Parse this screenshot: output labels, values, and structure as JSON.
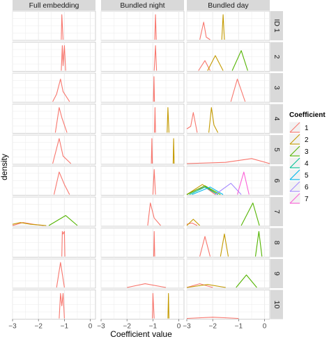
{
  "chart_data": {
    "type": "line",
    "xlabel": "Coefficient value",
    "ylabel": "density",
    "xlim": [
      -3,
      0.2
    ],
    "x_ticks": [
      "−3",
      "−2",
      "−1",
      "0"
    ],
    "x_tick_values": [
      -3,
      -2,
      -1,
      0
    ],
    "grid": true,
    "column_facets": [
      "Full embedding",
      "Bundled night",
      "Bundled day"
    ],
    "row_facets": [
      "ID 1",
      "2",
      "3",
      "4",
      "5",
      "6",
      "7",
      "8",
      "9",
      "10"
    ],
    "legend": {
      "title": "Coefficient",
      "placement": "right",
      "entries": [
        {
          "label": "1",
          "color": "#F8766D"
        },
        {
          "label": "2",
          "color": "#C49A00"
        },
        {
          "label": "3",
          "color": "#53B400"
        },
        {
          "label": "4",
          "color": "#00C094"
        },
        {
          "label": "5",
          "color": "#00B6EB"
        },
        {
          "label": "6",
          "color": "#A58AFF"
        },
        {
          "label": "7",
          "color": "#FB61D7"
        }
      ]
    },
    "panel_bg": "#ffffff",
    "grid_color": "#ebebeb",
    "strip_bg": "#d9d9d9",
    "panels": [
      [
        [
          {
            "c": "1",
            "x": [
              -1.12,
              -1.1,
              -1.05
            ],
            "y": [
              0,
              1,
              0
            ]
          }
        ],
        [
          {
            "c": "1",
            "x": [
              -0.93,
              -0.9,
              -0.87
            ],
            "y": [
              0,
              1,
              0
            ]
          }
        ],
        [
          {
            "c": "1",
            "x": [
              -2.5,
              -2.35,
              -2.25,
              -2.1
            ],
            "y": [
              0,
              0.7,
              0.1,
              0
            ]
          },
          {
            "c": "2",
            "x": [
              -1.65,
              -1.6,
              -1.55
            ],
            "y": [
              0,
              1,
              0
            ]
          }
        ]
      ],
      [
        [
          {
            "c": "1",
            "x": [
              -1.12,
              -1.08,
              -1.05,
              -1.0,
              -0.95
            ],
            "y": [
              0,
              1,
              0.2,
              1,
              0
            ]
          }
        ],
        [
          {
            "c": "1",
            "x": [
              -0.95,
              -0.9,
              -0.86
            ],
            "y": [
              0,
              1,
              0
            ]
          }
        ],
        [
          {
            "c": "1",
            "x": [
              -2.55,
              -2.3,
              -2.1
            ],
            "y": [
              0,
              0.4,
              0
            ]
          },
          {
            "c": "2",
            "x": [
              -2.2,
              -1.9,
              -1.6
            ],
            "y": [
              0,
              0.6,
              0
            ]
          },
          {
            "c": "3",
            "x": [
              -1.25,
              -0.9,
              -0.65
            ],
            "y": [
              0,
              0.8,
              0
            ]
          }
        ]
      ],
      [
        [
          {
            "c": "1",
            "x": [
              -1.45,
              -1.3,
              -1.15,
              -1.05,
              -0.8
            ],
            "y": [
              0,
              0.3,
              0.9,
              0.4,
              0
            ]
          }
        ],
        [
          {
            "c": "1",
            "x": [
              -0.98,
              -0.96,
              -0.94
            ],
            "y": [
              0,
              1,
              0
            ]
          }
        ],
        [
          {
            "c": "1",
            "x": [
              -1.3,
              -1.05,
              -0.75
            ],
            "y": [
              0,
              0.9,
              0
            ]
          }
        ]
      ],
      [
        [
          {
            "c": "1",
            "x": [
              -1.35,
              -1.2,
              -1.1,
              -0.9
            ],
            "y": [
              0,
              1,
              0.6,
              0
            ]
          }
        ],
        [
          {
            "c": "1",
            "x": [
              -0.94,
              -0.92,
              -0.9
            ],
            "y": [
              0,
              1,
              0
            ]
          },
          {
            "c": "2",
            "x": [
              -0.45,
              -0.42,
              -0.38
            ],
            "y": [
              0,
              1,
              0
            ]
          }
        ],
        [
          {
            "c": "1",
            "x": [
              -3,
              -2.85,
              -2.75,
              -2.6
            ],
            "y": [
              0.15,
              0.25,
              0.8,
              0
            ]
          },
          {
            "c": "2",
            "x": [
              -2.15,
              -2.05,
              -1.95,
              -1.8
            ],
            "y": [
              0,
              1,
              0.3,
              0
            ]
          }
        ]
      ],
      [
        [
          {
            "c": "1",
            "x": [
              -1.45,
              -1.2,
              -1.05,
              -0.9,
              -0.75
            ],
            "y": [
              0,
              1,
              0.3,
              0.15,
              0
            ]
          }
        ],
        [
          {
            "c": "1",
            "x": [
              -1.06,
              -1.04,
              -1.02
            ],
            "y": [
              0,
              1,
              0
            ]
          },
          {
            "c": "2",
            "x": [
              -0.22,
              -0.2,
              -0.18
            ],
            "y": [
              0,
              1,
              0
            ]
          }
        ],
        [
          {
            "c": "1",
            "x": [
              -3,
              -1.5,
              -0.5,
              0.2
            ],
            "y": [
              0,
              0.05,
              0.2,
              0
            ]
          }
        ]
      ],
      [
        [
          {
            "c": "1",
            "x": [
              -1.4,
              -1.2,
              -1.0,
              -0.8
            ],
            "y": [
              0,
              0.9,
              0.4,
              0
            ]
          }
        ],
        [
          {
            "c": "1",
            "x": [
              -1.0,
              -0.95,
              -0.9
            ],
            "y": [
              0,
              1,
              0
            ]
          }
        ],
        [
          {
            "c": "1",
            "x": [
              -3,
              -2.6,
              -2.3,
              -1.9
            ],
            "y": [
              0,
              0.2,
              0.3,
              0
            ]
          },
          {
            "c": "2",
            "x": [
              -3,
              -2.4,
              -1.8
            ],
            "y": [
              0,
              0.4,
              0
            ]
          },
          {
            "c": "3",
            "x": [
              -3,
              -2.3,
              -1.7
            ],
            "y": [
              0,
              0.35,
              0
            ]
          },
          {
            "c": "4",
            "x": [
              -2.9,
              -2.3,
              -1.8
            ],
            "y": [
              0,
              0.3,
              0
            ]
          },
          {
            "c": "5",
            "x": [
              -2.8,
              -2.1,
              -1.6
            ],
            "y": [
              0,
              0.3,
              0
            ]
          },
          {
            "c": "6",
            "x": [
              -1.9,
              -1.3,
              -0.9
            ],
            "y": [
              0,
              0.45,
              0
            ]
          },
          {
            "c": "7",
            "x": [
              -1.05,
              -0.8,
              -0.6
            ],
            "y": [
              0,
              0.9,
              0
            ]
          }
        ]
      ],
      [
        [
          {
            "c": "1",
            "x": [
              -3,
              -2.6,
              -2.2,
              -1.8
            ],
            "y": [
              0,
              0.12,
              0.05,
              0
            ]
          },
          {
            "c": "2",
            "x": [
              -3,
              -2.7,
              -2.3,
              -1.7
            ],
            "y": [
              0.05,
              0.12,
              0.05,
              0
            ]
          },
          {
            "c": "3",
            "x": [
              -1.6,
              -0.95,
              -0.5
            ],
            "y": [
              0,
              0.4,
              0
            ]
          }
        ],
        [
          {
            "c": "1",
            "x": [
              -1.2,
              -1.1,
              -0.95,
              -0.7
            ],
            "y": [
              0,
              0.9,
              0.3,
              0
            ]
          }
        ],
        [
          {
            "c": "1",
            "x": [
              -3,
              -2.8,
              -2.6
            ],
            "y": [
              0.05,
              0.1,
              0
            ]
          },
          {
            "c": "2",
            "x": [
              -3,
              -2.75,
              -2.5
            ],
            "y": [
              0,
              0.25,
              0
            ]
          },
          {
            "c": "3",
            "x": [
              -0.9,
              -0.45,
              -0.2
            ],
            "y": [
              0,
              0.9,
              0
            ]
          }
        ]
      ],
      [
        [
          {
            "c": "1",
            "x": [
              -1.1,
              -1.08,
              -1.05,
              -1.0,
              -0.98
            ],
            "y": [
              0,
              1,
              0.9,
              1,
              0
            ]
          }
        ],
        [
          {
            "c": "1",
            "x": [
              -0.97,
              -0.95,
              -0.93
            ],
            "y": [
              0,
              1,
              0
            ]
          }
        ],
        [
          {
            "c": "1",
            "x": [
              -2.5,
              -2.3,
              -2.1
            ],
            "y": [
              0,
              0.8,
              0
            ]
          },
          {
            "c": "2",
            "x": [
              -1.7,
              -1.55,
              -1.4
            ],
            "y": [
              0,
              0.9,
              0
            ]
          },
          {
            "c": "3",
            "x": [
              -0.35,
              -0.22,
              -0.1
            ],
            "y": [
              0,
              1,
              0
            ]
          }
        ]
      ],
      [
        [
          {
            "c": "1",
            "x": [
              -1.3,
              -1.15,
              -1.0
            ],
            "y": [
              0,
              1,
              0
            ]
          }
        ],
        [
          {
            "c": "1",
            "x": [
              -2,
              -1.3,
              -0.5
            ],
            "y": [
              0,
              0.15,
              0
            ]
          }
        ],
        [
          {
            "c": "1",
            "x": [
              -3,
              -2.5,
              -2.0
            ],
            "y": [
              0,
              0.15,
              0
            ]
          },
          {
            "c": "2",
            "x": [
              -3,
              -2.2,
              -1.5
            ],
            "y": [
              0,
              0.12,
              0
            ]
          },
          {
            "c": "3",
            "x": [
              -1.1,
              -0.7,
              -0.3
            ],
            "y": [
              0,
              0.5,
              0
            ]
          }
        ]
      ],
      [
        [
          {
            "c": "1",
            "x": [
              -1.2,
              -1.15,
              -1.1,
              -1.05,
              -1.0
            ],
            "y": [
              0,
              1,
              0.5,
              1,
              0
            ]
          }
        ],
        [
          {
            "c": "1",
            "x": [
              -1.02,
              -1.0,
              -0.95
            ],
            "y": [
              0,
              1,
              0
            ]
          },
          {
            "c": "2",
            "x": [
              -0.42,
              -0.4,
              -0.38
            ],
            "y": [
              0,
              1,
              0
            ]
          }
        ],
        [
          {
            "c": "1",
            "x": [
              -3,
              -2,
              -1
            ],
            "y": [
              0,
              0.05,
              0
            ]
          }
        ]
      ]
    ]
  }
}
